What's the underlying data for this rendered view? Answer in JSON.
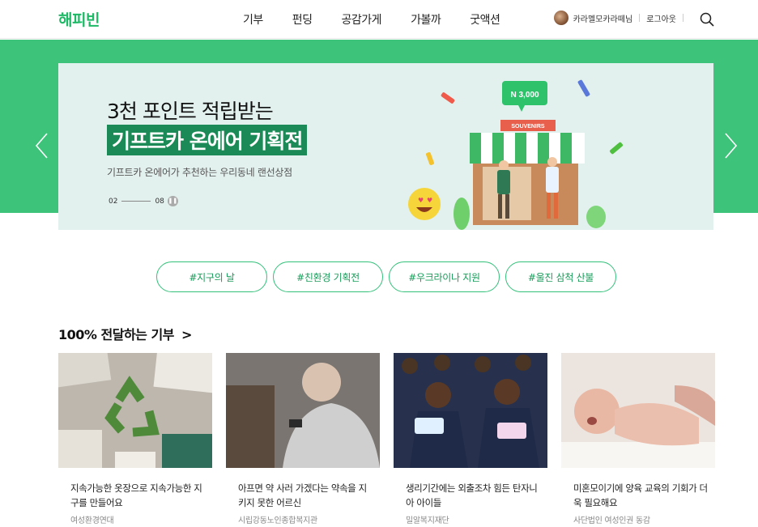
{
  "header": {
    "logo": "해피빈",
    "nav": [
      "기부",
      "펀딩",
      "공감가게",
      "가볼까",
      "굿액션"
    ],
    "user_name": "카라멜모카라떼님",
    "logout": "로그아웃"
  },
  "banner": {
    "title1": "3천 포인트 적립받는",
    "title2": "기프트카 온에어 기획전",
    "subtitle": "기프트카 온에어가 추천하는 우리동네 랜선상점",
    "page_current": "02",
    "page_total": "08",
    "price_tag": "N 3,000",
    "sign": "SOUVENIRS"
  },
  "hashtags": [
    "#지구의 날",
    "#친환경 기획전",
    "#우크라이나 지원",
    "#울진 삼척 산불"
  ],
  "section": {
    "title": "100% 전달하는 기부",
    "chevron": ">"
  },
  "cards": [
    {
      "title": "지속가능한 옷장으로 지속가능한 지구를 만들어요",
      "org": "여성환경연대"
    },
    {
      "title": "아프면 약 사러 가겠다는 약속을 지키지 못한 어르신",
      "org": "시립강동노인종합복지관"
    },
    {
      "title": "생리기간에는 외출조차 힘든 탄자니아 아이들",
      "org": "밀알복지재단"
    },
    {
      "title": "미혼모이기에 양육 교육의 기회가 더욱 필요해요",
      "org": "사단법인 여성인권 동감"
    }
  ],
  "colors": {
    "brand": "#1fb866",
    "banner_bg": "#3ec47a",
    "hero_bg": "#e3f1ee"
  }
}
